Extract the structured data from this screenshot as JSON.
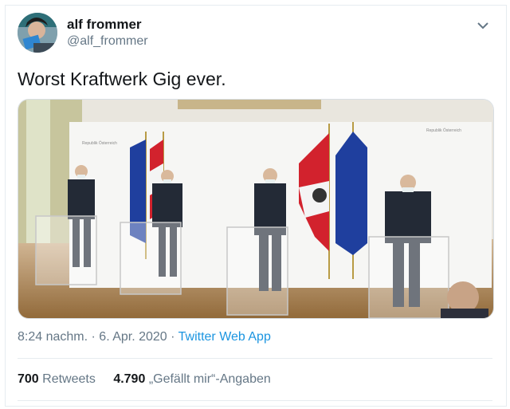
{
  "user": {
    "name": "alf frommer",
    "handle": "@alf_frommer"
  },
  "tweet": {
    "text": "Worst Kraftwerk Gig ever."
  },
  "media": {
    "label_left": "Republik Österreich",
    "label_right": "Republik Österreich"
  },
  "meta": {
    "time": "8:24 nachm.",
    "separator": "·",
    "date": "6. Apr. 2020",
    "app": "Twitter Web App"
  },
  "stats": {
    "retweets_count": "700",
    "retweets_label": "Retweets",
    "likes_count": "4.790",
    "likes_label": "„Gefällt mir“-Angaben"
  },
  "colors": {
    "link": "#1b95e0",
    "muted": "#657786"
  }
}
